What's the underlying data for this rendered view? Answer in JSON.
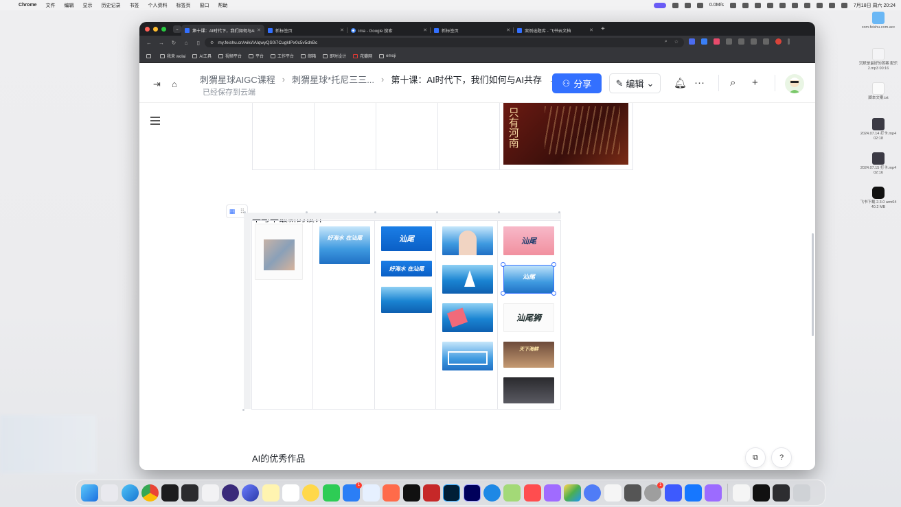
{
  "menubar": {
    "app": "Chrome",
    "items": [
      "文件",
      "编辑",
      "显示",
      "历史记录",
      "书签",
      "个人资料",
      "标签页",
      "窗口",
      "帮助"
    ],
    "net_speed": "0.0M/s",
    "clock": "7月18日 周六 20:24"
  },
  "desktop_icons": [
    {
      "label": "com.feishu.com.acc"
    },
    {
      "label": "沉默是最好的答案 配乐 2.mp3 00:16"
    },
    {
      "label": "脚本文案.txt"
    },
    {
      "label": "2024.07.14 打卡.mp4 02:18"
    },
    {
      "label": "2024.07.15 打卡.mp4 02:16"
    },
    {
      "label": "飞书下载 2.3.0 arm64 40.2 MB"
    }
  ],
  "browser": {
    "tabs": [
      {
        "title": "第十课：AI时代下，我们如何与AI共存",
        "active": true,
        "color": "#3370ff"
      },
      {
        "title": "新标签页",
        "active": false,
        "color": "#3370ff"
      },
      {
        "title": "ima - Google 搜索",
        "active": false,
        "color": "#4285f4"
      },
      {
        "title": "新标签页",
        "active": false,
        "color": "#3370ff"
      },
      {
        "title": "案例选题库 - 飞书云文档",
        "active": false,
        "color": "#3370ff"
      }
    ],
    "url": "my.feishu.cn/wiki/IAIqwyQS0i7CugkIPx0c5v5dnBc",
    "bookmarks": [
      "我来 wolai",
      "AI工具",
      "视频平台",
      "平台",
      "工作平台",
      "邮箱",
      "即时设计",
      "花瓣网",
      "emoji"
    ]
  },
  "doc": {
    "breadcrumbs": [
      "刺猬星球AIGC课程",
      "刺猬星球*托尼三三...",
      "第十课：AI时代下，我们如何与AI共存"
    ],
    "saved_status": "已经保存到云端",
    "share_label": "分享",
    "edit_label": "编辑",
    "section1_title": "华与华最新的设计",
    "section2_title": "AI的优秀作品",
    "poster_text": "只有河南",
    "table_logos": {
      "shanwei": "汕尾",
      "haiwater": "好海水 在汕尾",
      "shanweishi": "汕尾狮",
      "tianxia": "天下海鲜"
    }
  },
  "colors": {
    "accent": "#3370ff",
    "tab_bar": "#1f2023",
    "toolbar": "#35363a"
  }
}
